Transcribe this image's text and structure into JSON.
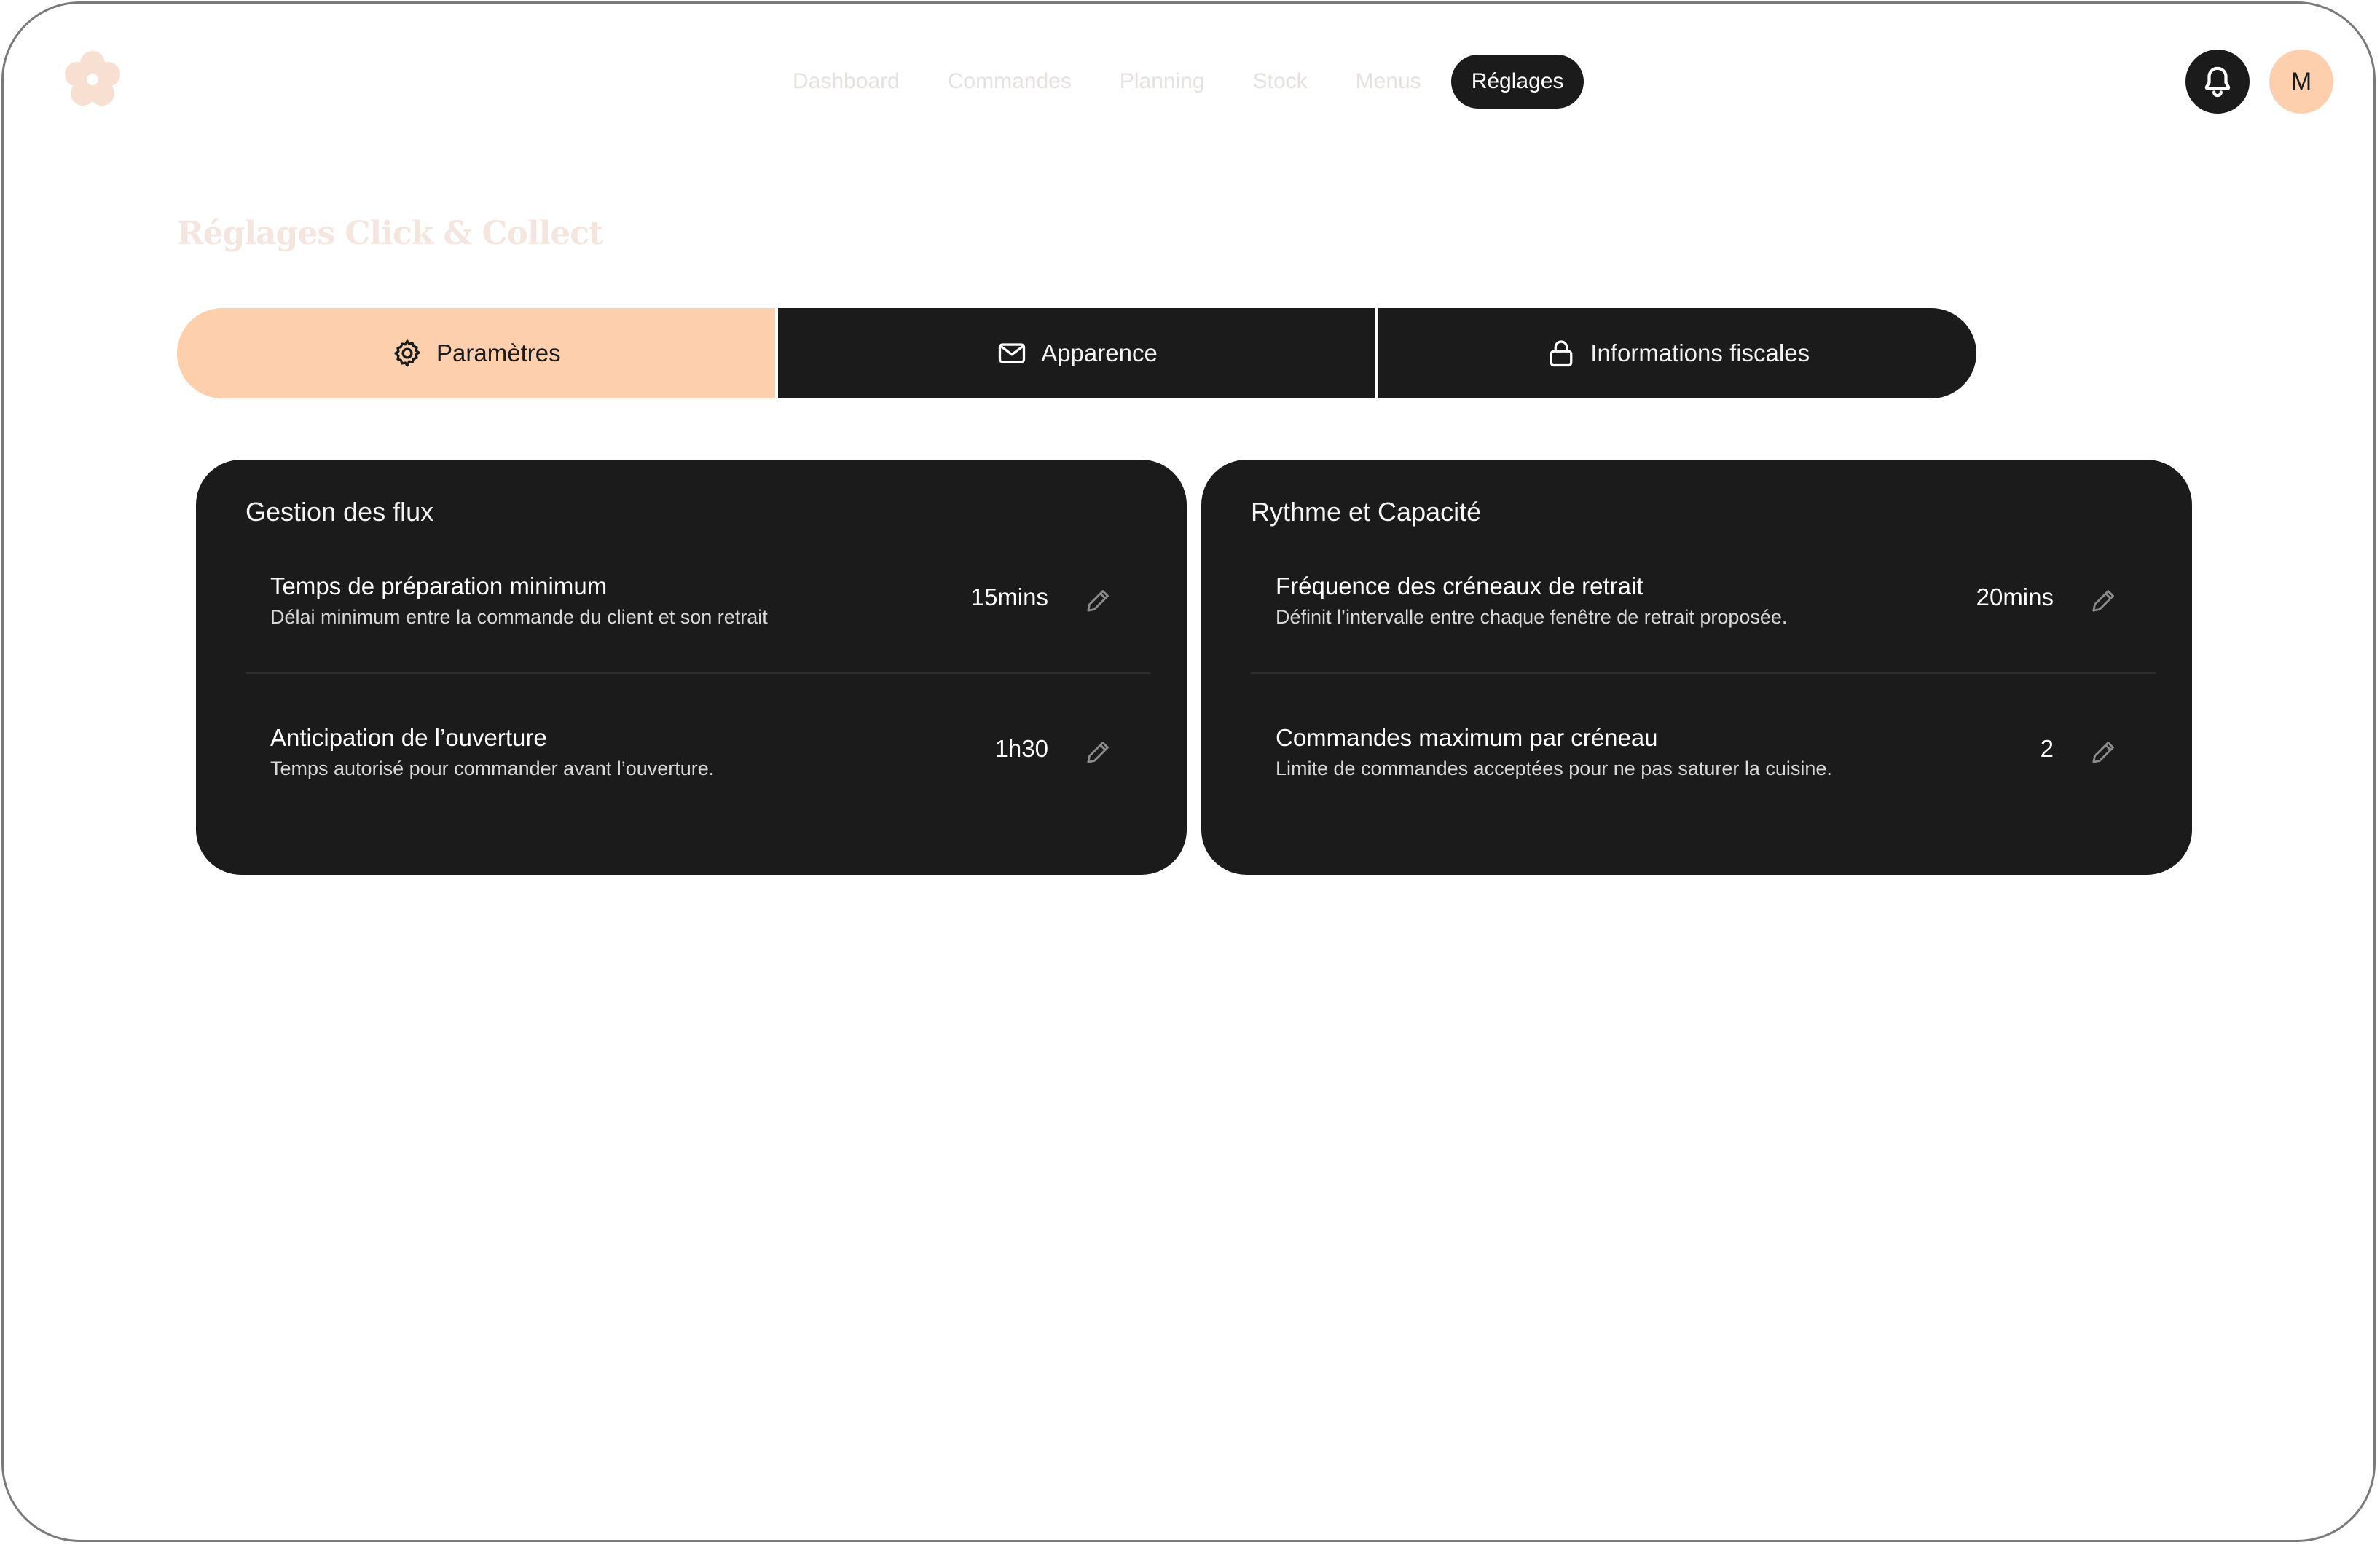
{
  "header": {
    "logo_icon": "flower-logo-icon",
    "nav": [
      {
        "label": "Dashboard"
      },
      {
        "label": "Commandes"
      },
      {
        "label": "Planning"
      },
      {
        "label": "Stock"
      },
      {
        "label": "Menus"
      },
      {
        "label": "Réglages",
        "active": true
      }
    ],
    "bell_icon": "bell-icon",
    "avatar_initial": "M"
  },
  "page": {
    "title": "Réglages Click & Collect"
  },
  "tabs": [
    {
      "label": "Paramètres",
      "icon": "gear-icon",
      "active": true
    },
    {
      "label": "Apparence",
      "icon": "mail-icon"
    },
    {
      "label": "Informations fiscales",
      "icon": "lock-icon"
    }
  ],
  "cards": {
    "flux": {
      "title": "Gestion des flux",
      "rows": [
        {
          "label": "Temps de préparation minimum",
          "description": "Délai minimum entre la commande du client et son retrait",
          "value": "15mins"
        },
        {
          "label": "Anticipation de l’ouverture",
          "description": "Temps autorisé pour commander avant l’ouverture.",
          "value": "1h30"
        }
      ]
    },
    "rythme": {
      "title": "Rythme et Capacité",
      "rows": [
        {
          "label": "Fréquence des créneaux de retrait",
          "description": "Définit l’intervalle entre chaque fenêtre de retrait proposée.",
          "value": "20mins"
        },
        {
          "label": "Commandes maximum par créneau",
          "description": "Limite de commandes acceptées pour ne pas saturer la cuisine.",
          "value": "2"
        }
      ]
    }
  },
  "colors": {
    "accent": "#fdcfad",
    "dark": "#1b1b1b",
    "nav_inactive": "#e6e1de"
  }
}
